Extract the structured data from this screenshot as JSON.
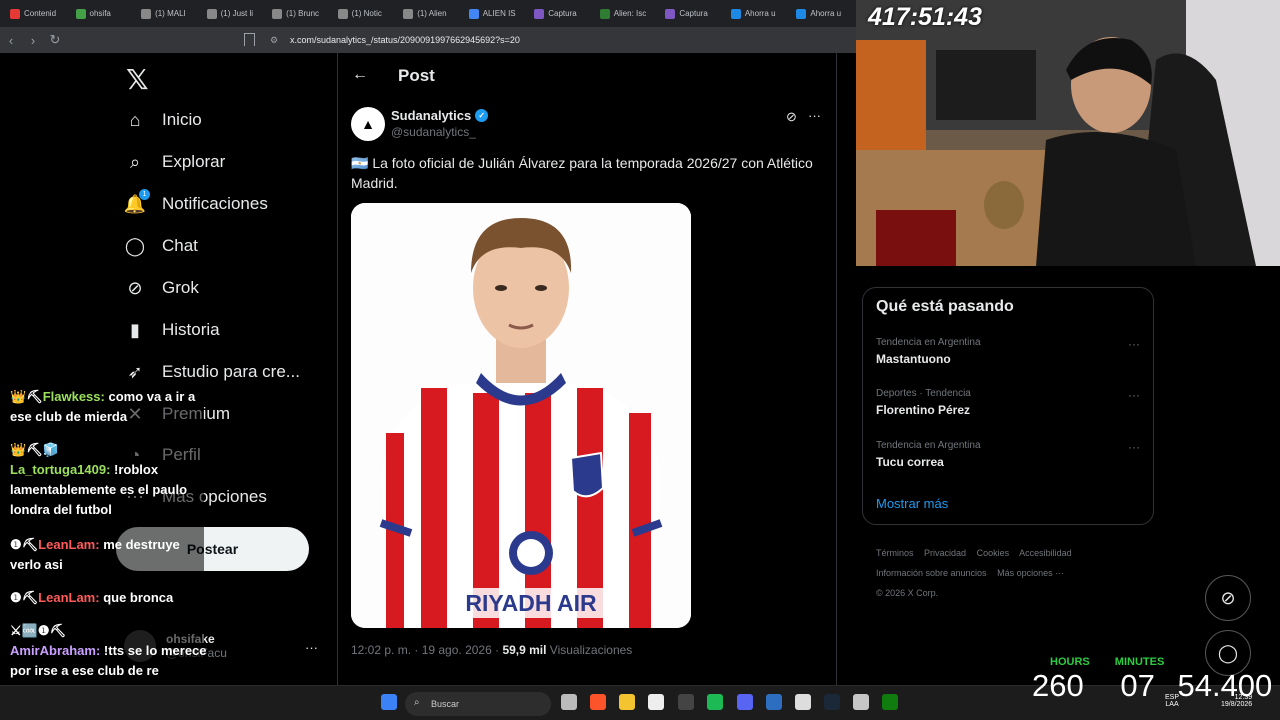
{
  "browser": {
    "tabs": [
      "Contenid",
      "ohsifa",
      "(1) MALI",
      "(1) Just li",
      "(1) Brunc",
      "(1) Notic",
      "(1) Alien",
      "ALIEN IS",
      "Captura",
      "Alien: Isc",
      "Captura",
      "Ahorra u",
      "Ahorra u"
    ],
    "url": "x.com/sudanalytics_/status/2090091997662945692?s=20"
  },
  "sidebar": {
    "logo": "𝕏",
    "items": [
      {
        "label": "Inicio",
        "icon": "⌂"
      },
      {
        "label": "Explorar",
        "icon": "⌕"
      },
      {
        "label": "Notificaciones",
        "icon": "🔔",
        "badge": "1"
      },
      {
        "label": "Chat",
        "icon": "◯"
      },
      {
        "label": "Grok",
        "icon": "⊘"
      },
      {
        "label": "Historia",
        "icon": "▮"
      },
      {
        "label": "Estudio para cre...",
        "icon": "➶"
      },
      {
        "label": "Premium",
        "icon": "✕"
      },
      {
        "label": "Perfil",
        "icon": "◔"
      },
      {
        "label": "Más opciones",
        "icon": "⋯"
      }
    ],
    "post_button": "Postear",
    "account": {
      "name": "ohsifake",
      "handle": "@ohsiFacu"
    }
  },
  "post": {
    "header": "Post",
    "author": "Sudanalytics",
    "handle": "@sudanalytics_",
    "text": "🇦🇷 La foto oficial de Julián Álvarez para la temporada 2026/27 con Atlético Madrid.",
    "sponsor_text": "RIYADH AIR",
    "time": "12:02 p. m. · 19 ago. 2026 · ",
    "views_count": "59,9 mil",
    "views_label": " Visualizaciones"
  },
  "trends": {
    "title": "Qué está pasando",
    "items": [
      {
        "context": "Tendencia en Argentina",
        "name": "Mastantuono"
      },
      {
        "context": "Deportes · Tendencia",
        "name": "Florentino Pérez"
      },
      {
        "context": "Tendencia en Argentina",
        "name": "Tucu correa"
      }
    ],
    "show_more": "Mostrar más"
  },
  "footer": {
    "links": [
      "Términos",
      "Privacidad",
      "Cookies",
      "Accesibilidad",
      "Información sobre anuncios",
      "Más opciones ···"
    ],
    "copyright": "© 2026 X Corp."
  },
  "stream": {
    "timer": "417:51:43",
    "counter_labels": {
      "hours": "HOURS",
      "minutes": "MINUTES"
    },
    "counter_hours": "260",
    "counter_minutes": "07",
    "counter_seconds": "54.400"
  },
  "chat": [
    {
      "user": "Flawkess:",
      "text": " como va a ir a ese club de mierda"
    },
    {
      "user": "La_tortuga1409:",
      "text": " !roblox lamentablemente es el paulo londra del futbol"
    },
    {
      "user": "LeanLam:",
      "text": " me destruye verlo asi"
    },
    {
      "user": "LeanLam:",
      "text": " que bronca"
    },
    {
      "user": "AmirAbraham:",
      "text": " !tts se lo merece por irse a ese club de re poronga"
    }
  ],
  "taskbar": {
    "search_placeholder": "Buscar",
    "lang": "ESP",
    "lang2": "LAA",
    "time": "12:39",
    "date": "19/8/2026"
  },
  "colors": {
    "accent": "#1d9bf0",
    "bg": "#000000",
    "chat_user": "#7ec8e3",
    "counter_label": "#2ecc40"
  }
}
